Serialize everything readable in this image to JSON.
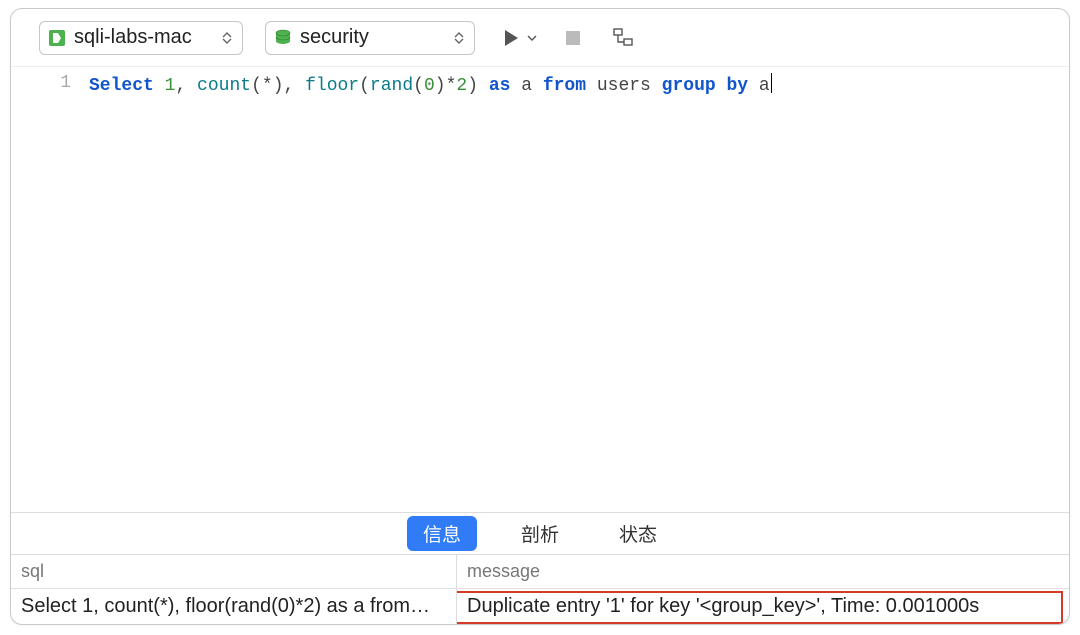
{
  "toolbar": {
    "connection": "sqli-labs-mac",
    "database": "security"
  },
  "editor": {
    "lineNumbers": [
      "1"
    ],
    "tokens": [
      {
        "t": "Select",
        "c": "kw"
      },
      {
        "t": " ",
        "c": "tok"
      },
      {
        "t": "1",
        "c": "num"
      },
      {
        "t": ", ",
        "c": "tok"
      },
      {
        "t": "count",
        "c": "fn"
      },
      {
        "t": "(",
        "c": "tok"
      },
      {
        "t": "*",
        "c": "tok"
      },
      {
        "t": "), ",
        "c": "tok"
      },
      {
        "t": "floor",
        "c": "fn"
      },
      {
        "t": "(",
        "c": "tok"
      },
      {
        "t": "rand",
        "c": "fn"
      },
      {
        "t": "(",
        "c": "tok"
      },
      {
        "t": "0",
        "c": "num"
      },
      {
        "t": ")",
        "c": "tok"
      },
      {
        "t": "*",
        "c": "tok"
      },
      {
        "t": "2",
        "c": "num"
      },
      {
        "t": ") ",
        "c": "tok"
      },
      {
        "t": "as",
        "c": "kw"
      },
      {
        "t": " a ",
        "c": "tok"
      },
      {
        "t": "from",
        "c": "kw"
      },
      {
        "t": " users ",
        "c": "tok"
      },
      {
        "t": "group",
        "c": "kw"
      },
      {
        "t": " ",
        "c": "tok"
      },
      {
        "t": "by",
        "c": "kw"
      },
      {
        "t": " a",
        "c": "tok"
      }
    ]
  },
  "tabs": {
    "info": "信息",
    "profile": "剖析",
    "status": "状态"
  },
  "result": {
    "headers": {
      "sql": "sql",
      "message": "message"
    },
    "rows": [
      {
        "sql": "Select 1, count(*), floor(rand(0)*2) as a from…",
        "message": "Duplicate entry '1' for key '<group_key>', Time: 0.001000s"
      }
    ]
  }
}
